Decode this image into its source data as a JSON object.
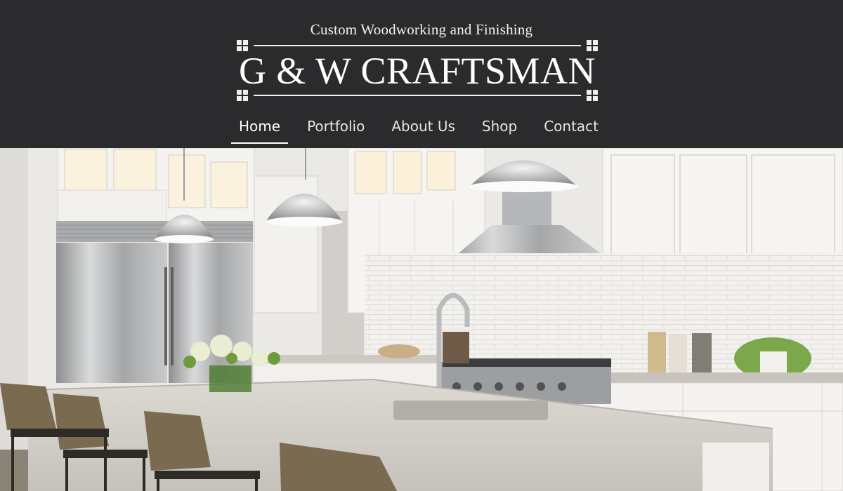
{
  "header": {
    "tagline": "Custom Woodworking and Finishing",
    "brand": "G & W CRAFTSMAN",
    "colors": {
      "background": "#2b2b2d",
      "text": "#ffffff"
    }
  },
  "nav": {
    "items": [
      {
        "label": "Home",
        "active": true
      },
      {
        "label": "Portfolio",
        "active": false
      },
      {
        "label": "About Us",
        "active": false
      },
      {
        "label": "Shop",
        "active": false
      },
      {
        "label": "Contact",
        "active": false
      }
    ]
  },
  "hero": {
    "image": "kitchen-photo"
  }
}
